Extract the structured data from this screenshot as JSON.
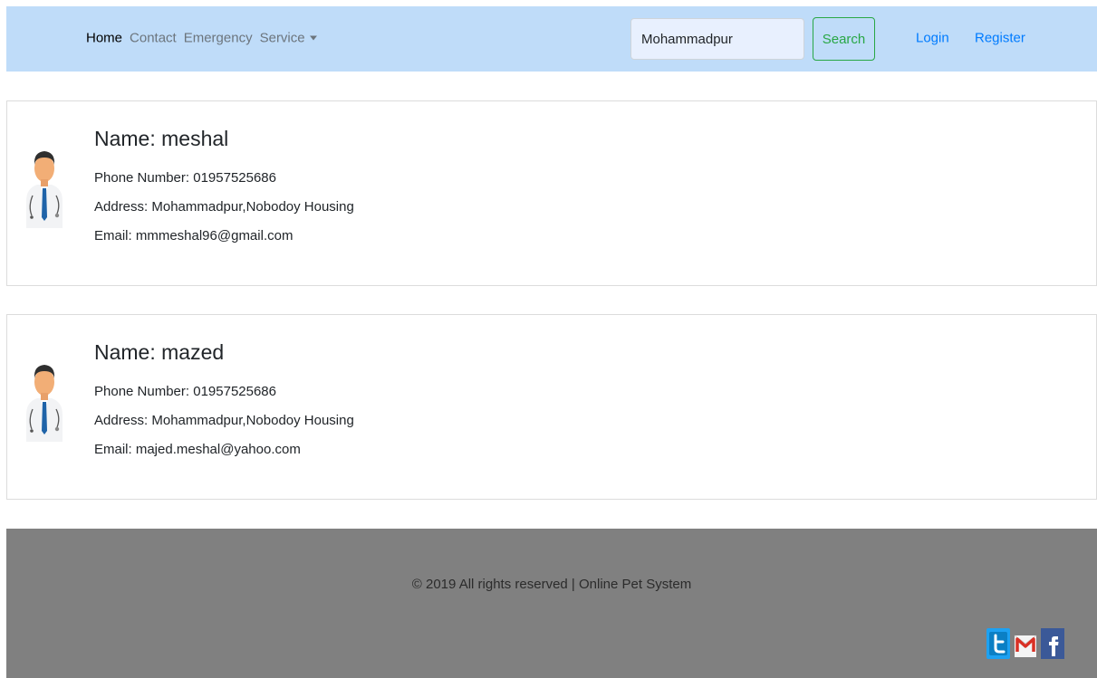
{
  "nav": {
    "items": [
      {
        "label": "Home",
        "active": true
      },
      {
        "label": "Contact",
        "active": false
      },
      {
        "label": "Emergency",
        "active": false
      },
      {
        "label": "Service",
        "active": false
      }
    ],
    "search": {
      "value": "Mohammadpur",
      "button_label": "Search"
    },
    "login_label": "Login",
    "register_label": "Register"
  },
  "doctors": [
    {
      "name": "Name: meshal",
      "phone": "Phone Number: 01957525686",
      "address": "Address: Mohammadpur,Nobodoy Housing",
      "email": "Email: mmmeshal96@gmail.com"
    },
    {
      "name": "Name: mazed",
      "phone": "Phone Number: 01957525686",
      "address": "Address: Mohammadpur,Nobodoy Housing",
      "email": "Email: majed.meshal@yahoo.com"
    }
  ],
  "footer": {
    "copyright": "© 2019 All rights reserved | Online Pet System",
    "social_icons": [
      "twitter-icon",
      "gmail-icon",
      "facebook-icon"
    ]
  },
  "colors": {
    "navbar_bg": "#bfdcf9",
    "link_blue": "#007bff",
    "search_green": "#28a745",
    "footer_bg": "#808080"
  }
}
